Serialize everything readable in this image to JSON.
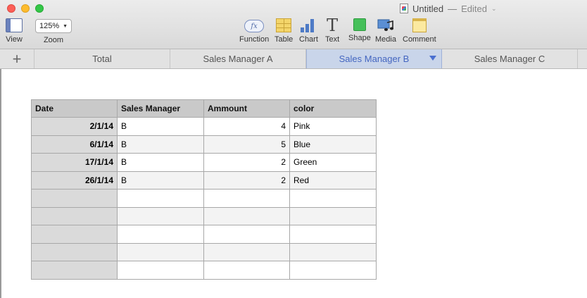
{
  "window": {
    "title": "Untitled",
    "separator": "—",
    "status": "Edited"
  },
  "toolbar": {
    "view_label": "View",
    "zoom_value": "125%",
    "zoom_label": "Zoom",
    "function_icon_text": "fx",
    "function_label": "Function",
    "table_label": "Table",
    "chart_label": "Chart",
    "text_icon_text": "T",
    "text_label": "Text",
    "shape_label": "Shape",
    "media_label": "Media",
    "comment_label": "Comment"
  },
  "tabs": {
    "add_symbol": "+",
    "items": [
      {
        "label": "Total"
      },
      {
        "label": "Sales Manager A"
      },
      {
        "label": "Sales Manager B"
      },
      {
        "label": "Sales Manager C"
      }
    ],
    "active_index": 2
  },
  "table": {
    "headers": [
      "Date",
      "Sales Manager",
      "Ammount",
      "color"
    ],
    "rows": [
      [
        "2/1/14",
        "B",
        "4",
        "Pink"
      ],
      [
        "6/1/14",
        "B",
        "5",
        "Blue"
      ],
      [
        "17/1/14",
        "B",
        "2",
        "Green"
      ],
      [
        "26/1/14",
        "B",
        "2",
        "Red"
      ],
      [
        "",
        "",
        "",
        ""
      ],
      [
        "",
        "",
        "",
        ""
      ],
      [
        "",
        "",
        "",
        ""
      ],
      [
        "",
        "",
        "",
        ""
      ],
      [
        "",
        "",
        "",
        ""
      ]
    ]
  },
  "colors": {
    "active_tab_bg": "#c9d5ea",
    "active_tab_text": "#4466c0",
    "header_bg": "#c9c9c9",
    "date_col_bg": "#dadada"
  }
}
